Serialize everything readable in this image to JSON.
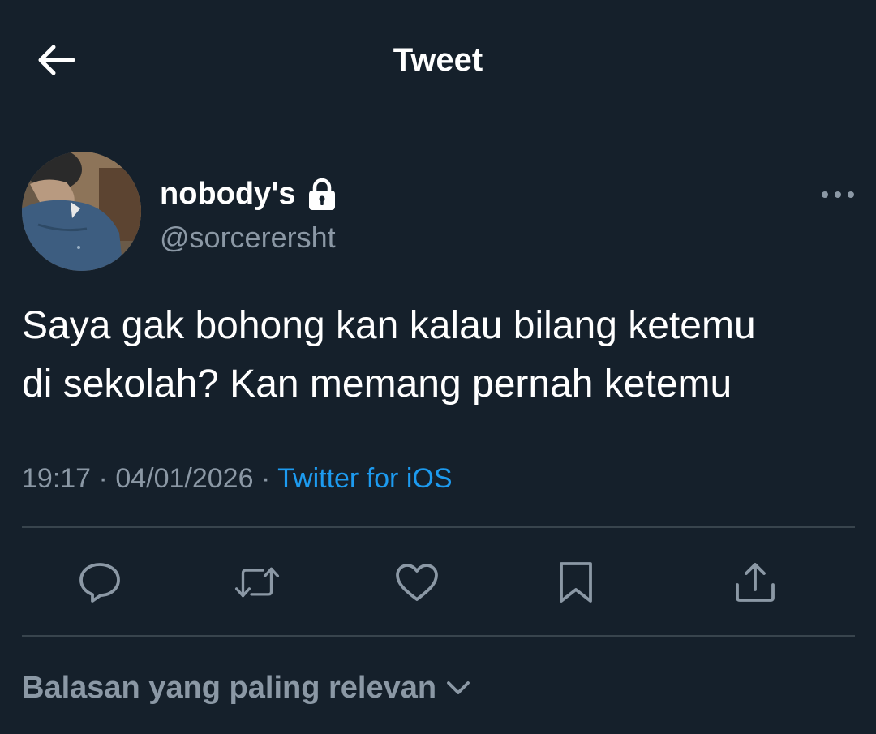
{
  "header": {
    "title": "Tweet",
    "back_icon": "arrow-left-icon"
  },
  "author": {
    "display_name": "nobody's",
    "handle": "@sorcerersht",
    "protected_icon": "lock-icon",
    "more_icon": "more-horizontal-icon"
  },
  "tweet": {
    "text_line1": "Saya gak bohong kan kalau bilang ketemu",
    "text_line2": "di sekolah? Kan memang pernah ketemu",
    "time": "19:17",
    "separator": "·",
    "date": "04/01/2026",
    "source": "Twitter for iOS"
  },
  "actions": [
    {
      "icon": "reply-icon"
    },
    {
      "icon": "retweet-icon"
    },
    {
      "icon": "like-icon"
    },
    {
      "icon": "bookmark-icon"
    },
    {
      "icon": "share-icon"
    }
  ],
  "replies": {
    "sort_label": "Balasan yang paling relevan",
    "sort_icon": "chevron-down-icon"
  },
  "colors": {
    "background": "#15202b",
    "text": "#ffffff",
    "secondary_text": "#8b98a5",
    "accent": "#1d9bf0",
    "divider": "#38444d"
  }
}
